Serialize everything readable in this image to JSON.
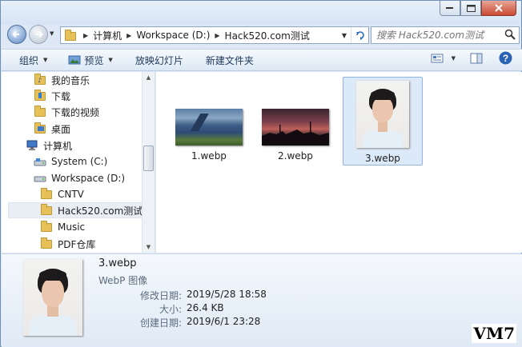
{
  "window": {
    "caption_buttons": [
      "minimize",
      "maximize",
      "close"
    ]
  },
  "address": {
    "segments": [
      "计算机",
      "Workspace (D:)",
      "Hack520.com测试"
    ]
  },
  "search": {
    "placeholder": "搜索 Hack520.com测试"
  },
  "toolbar": {
    "organize_label": "组织",
    "preview_label": "预览",
    "slideshow_label": "放映幻灯片",
    "new_folder_label": "新建文件夹"
  },
  "nav": {
    "items": [
      {
        "label": "我的音乐",
        "icon": "music-folder-icon"
      },
      {
        "label": "下载",
        "icon": "download-folder-icon"
      },
      {
        "label": "下载的视频",
        "icon": "folder-icon"
      },
      {
        "label": "桌面",
        "icon": "desktop-folder-icon"
      },
      {
        "label": "计算机",
        "icon": "computer-icon"
      },
      {
        "label": "System (C:)",
        "icon": "system-drive-icon"
      },
      {
        "label": "Workspace (D:)",
        "icon": "drive-icon"
      },
      {
        "label": "CNTV",
        "icon": "folder-icon"
      },
      {
        "label": "Hack520.com测试",
        "icon": "folder-icon"
      },
      {
        "label": "Music",
        "icon": "folder-icon"
      },
      {
        "label": "PDF仓库",
        "icon": "folder-icon"
      }
    ]
  },
  "files": [
    {
      "name": "1.webp",
      "thumbnail": "fjord-landscape"
    },
    {
      "name": "2.webp",
      "thumbnail": "sunset-sky"
    },
    {
      "name": "3.webp",
      "thumbnail": "portrait-photo"
    }
  ],
  "selected_file": "3.webp",
  "details": {
    "name": "3.webp",
    "type": "WebP 图像",
    "modified_label": "修改日期:",
    "modified_value": "2019/5/28 18:58",
    "size_label": "大小:",
    "size_value": "26.4 KB",
    "created_label": "创建日期:",
    "created_value": "2019/6/1 23:28"
  },
  "watermark": "VM7",
  "colors": {
    "selection": "#dce9f8",
    "folder": "#e8c05a",
    "chrome": "#dfe9f5",
    "close_button": "#c84a34"
  }
}
